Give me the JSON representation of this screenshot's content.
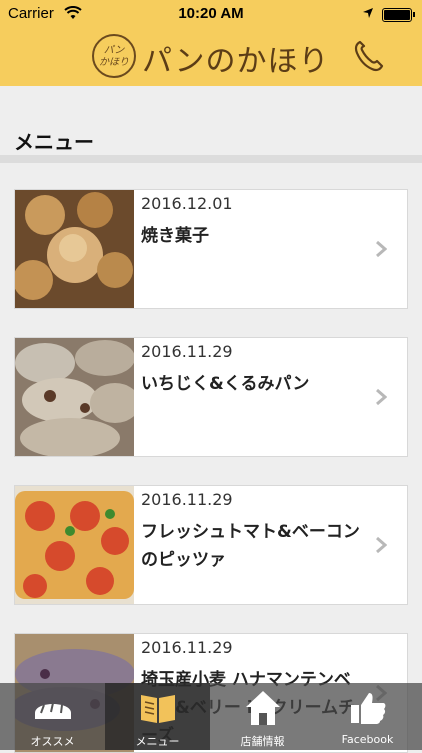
{
  "status_bar": {
    "carrier": "Carrier",
    "time": "10:20 AM"
  },
  "header": {
    "logo_text": "パン\nかほり",
    "title": "パンのかほり",
    "phone_icon": "phone-icon"
  },
  "section": {
    "title": "メニュー"
  },
  "menu_items": [
    {
      "date": "2016.12.01",
      "title": "焼き菓子"
    },
    {
      "date": "2016.11.29",
      "title": "いちじく&くるみパン"
    },
    {
      "date": "2016.11.29",
      "title": "フレッシュトマト&ベーコンのピッツァ"
    },
    {
      "date": "2016.11.29",
      "title": "埼玉産小麦 ハナマンテンベリー&ベリー in クリームチーズ"
    }
  ],
  "tabs": [
    {
      "label": "オススメ",
      "icon": "bread-icon",
      "active": false
    },
    {
      "label": "メニュー",
      "icon": "book-icon",
      "active": true
    },
    {
      "label": "店舗情報",
      "icon": "house-icon",
      "active": false
    },
    {
      "label": "Facebook",
      "icon": "thumbs-up-icon",
      "active": false
    }
  ],
  "colors": {
    "header_bg": "#f6cd5d",
    "brand_text": "#5c3d16"
  }
}
